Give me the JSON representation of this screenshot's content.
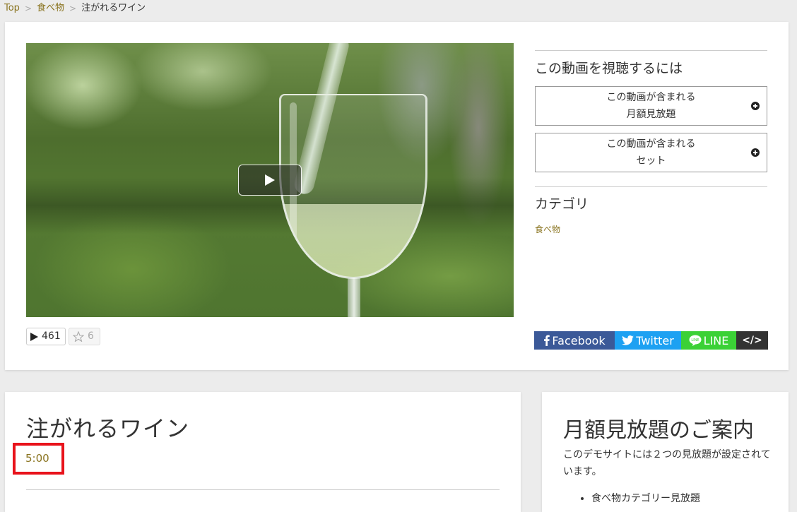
{
  "breadcrumb": {
    "items": [
      "Top",
      "食べ物"
    ],
    "current": "注がれるワイン",
    "separator": ">"
  },
  "video": {
    "play_icon": "play-icon",
    "plays": "461",
    "favorites": "6"
  },
  "sidebar": {
    "watch_heading": "この動画を視聴するには",
    "plans": [
      {
        "line1": "この動画が含まれる",
        "line2": "月額見放題"
      },
      {
        "line1": "この動画が含まれる",
        "line2": "セット"
      }
    ],
    "category_heading": "カテゴリ",
    "category_link": "食べ物"
  },
  "share": {
    "facebook": "Facebook",
    "twitter": "Twitter",
    "line": "LINE",
    "embed": "</>"
  },
  "details": {
    "title": "注がれるワイン",
    "duration": "5:00"
  },
  "info": {
    "title": "月額見放題のご案内",
    "text": "このデモサイトには２つの見放題が設定されています。",
    "list": [
      "食べ物カテゴリー見放題"
    ]
  },
  "colors": {
    "link": "#8a7420",
    "facebook": "#3b5998",
    "twitter": "#1da1f2",
    "line": "#3bd136",
    "highlight": "#e8131b"
  }
}
